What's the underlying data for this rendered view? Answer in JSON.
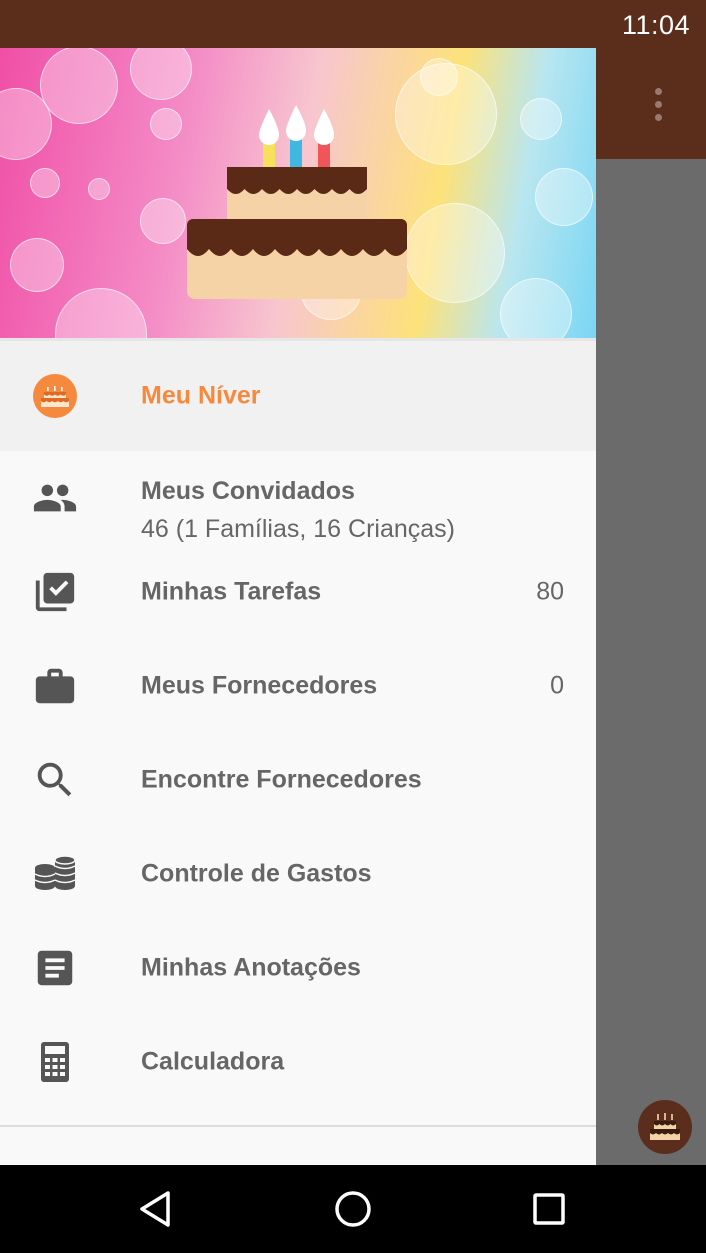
{
  "status_bar": {
    "time": "11:04"
  },
  "colors": {
    "accent": "#f58a3e",
    "app_bar": "#5b2e1b",
    "icon_gray": "#555555"
  },
  "drawer": {
    "header_image": "birthday-cake-banner",
    "items": [
      {
        "label": "Meu Níver",
        "icon": "birthday-cake-icon",
        "active": true
      },
      {
        "label": "Meus Convidados",
        "sub": "46 (1 Famílias, 16 Crianças)",
        "icon": "people-icon"
      },
      {
        "label": "Minhas Tarefas",
        "count": "80",
        "icon": "checklist-icon"
      },
      {
        "label": "Meus Fornecedores",
        "count": "0",
        "icon": "briefcase-icon"
      },
      {
        "label": "Encontre Fornecedores",
        "icon": "search-icon"
      },
      {
        "label": "Controle de Gastos",
        "icon": "coins-icon"
      },
      {
        "label": "Minhas Anotações",
        "icon": "notes-icon"
      },
      {
        "label": "Calculadora",
        "icon": "calculator-icon"
      }
    ]
  },
  "nav_bar": {
    "back": "back-icon",
    "home": "home-icon",
    "recents": "recents-icon"
  }
}
